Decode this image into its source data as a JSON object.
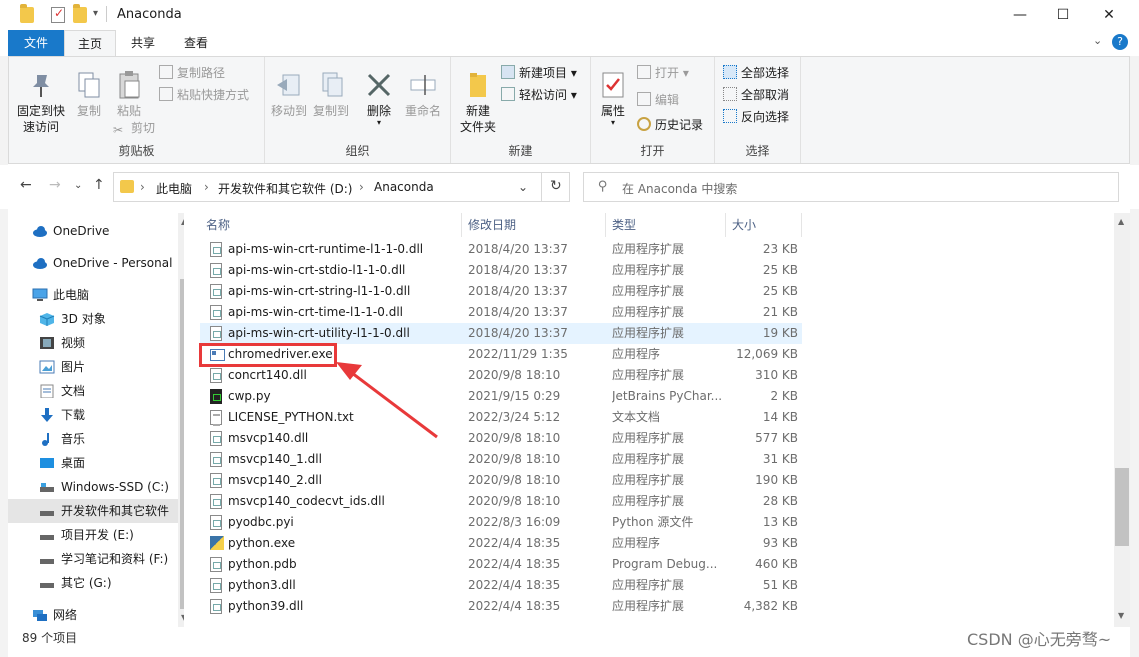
{
  "window": {
    "title": "Anaconda",
    "minimize": "—",
    "maximize": "☐",
    "close": "✕"
  },
  "ribbon_tabs": [
    "文件",
    "主页",
    "共享",
    "查看"
  ],
  "ribbon": {
    "clipboard": {
      "pin": "固定到快速访问",
      "pin_l1": "固定到快",
      "pin_l2": "速访问",
      "copy": "复制",
      "paste": "粘贴",
      "copy_path": "复制路径",
      "paste_shortcut": "粘贴快捷方式",
      "cut": "剪切",
      "label": "剪贴板"
    },
    "organize": {
      "move_to": "移动到",
      "copy_to": "复制到",
      "delete": "删除",
      "rename": "重命名",
      "label": "组织"
    },
    "new": {
      "new_folder_l1": "新建",
      "new_folder_l2": "文件夹",
      "new_item": "新建项目",
      "easy_access": "轻松访问",
      "label": "新建"
    },
    "open": {
      "properties": "属性",
      "open": "打开",
      "edit": "编辑",
      "history": "历史记录",
      "label": "打开"
    },
    "select": {
      "select_all": "全部选择",
      "select_none": "全部取消",
      "invert": "反向选择",
      "label": "选择"
    }
  },
  "address": {
    "segments": [
      "此电脑",
      "开发软件和其它软件 (D:)",
      "Anaconda"
    ],
    "search_placeholder": "在 Anaconda 中搜索"
  },
  "nav": [
    {
      "label": "OneDrive",
      "icon": "cloud-icon"
    },
    {
      "label": "OneDrive - Personal",
      "icon": "cloud-icon"
    },
    {
      "label": "此电脑",
      "icon": "computer-icon"
    },
    {
      "label": "3D 对象",
      "icon": "3d-objects-icon"
    },
    {
      "label": "视频",
      "icon": "video-icon"
    },
    {
      "label": "图片",
      "icon": "pictures-icon"
    },
    {
      "label": "文档",
      "icon": "documents-icon"
    },
    {
      "label": "下载",
      "icon": "download-icon"
    },
    {
      "label": "音乐",
      "icon": "music-icon"
    },
    {
      "label": "桌面",
      "icon": "desktop-icon"
    },
    {
      "label": "Windows-SSD (C:)",
      "icon": "drive-icon"
    },
    {
      "label": "开发软件和其它软件",
      "icon": "drive-icon"
    },
    {
      "label": "项目开发 (E:)",
      "icon": "drive-icon"
    },
    {
      "label": "学习笔记和资料 (F:)",
      "icon": "drive-icon"
    },
    {
      "label": "其它 (G:)",
      "icon": "drive-icon"
    },
    {
      "label": "网络",
      "icon": "network-icon"
    }
  ],
  "columns": {
    "name": "名称",
    "date": "修改日期",
    "type": "类型",
    "size": "大小"
  },
  "files": [
    {
      "name": "api-ms-win-crt-runtime-l1-1-0.dll",
      "date": "2018/4/20 13:37",
      "type": "应用程序扩展",
      "size": "23 KB",
      "icon": "dll"
    },
    {
      "name": "api-ms-win-crt-stdio-l1-1-0.dll",
      "date": "2018/4/20 13:37",
      "type": "应用程序扩展",
      "size": "25 KB",
      "icon": "dll"
    },
    {
      "name": "api-ms-win-crt-string-l1-1-0.dll",
      "date": "2018/4/20 13:37",
      "type": "应用程序扩展",
      "size": "25 KB",
      "icon": "dll"
    },
    {
      "name": "api-ms-win-crt-time-l1-1-0.dll",
      "date": "2018/4/20 13:37",
      "type": "应用程序扩展",
      "size": "21 KB",
      "icon": "dll"
    },
    {
      "name": "api-ms-win-crt-utility-l1-1-0.dll",
      "date": "2018/4/20 13:37",
      "type": "应用程序扩展",
      "size": "19 KB",
      "icon": "dll"
    },
    {
      "name": "chromedriver.exe",
      "date": "2022/11/29 1:35",
      "type": "应用程序",
      "size": "12,069 KB",
      "icon": "exe"
    },
    {
      "name": "concrt140.dll",
      "date": "2020/9/8 18:10",
      "type": "应用程序扩展",
      "size": "310 KB",
      "icon": "dll"
    },
    {
      "name": "cwp.py",
      "date": "2021/9/15 0:29",
      "type": "JetBrains PyChar...",
      "size": "2 KB",
      "icon": "pyc"
    },
    {
      "name": "LICENSE_PYTHON.txt",
      "date": "2022/3/24 5:12",
      "type": "文本文档",
      "size": "14 KB",
      "icon": "txt"
    },
    {
      "name": "msvcp140.dll",
      "date": "2020/9/8 18:10",
      "type": "应用程序扩展",
      "size": "577 KB",
      "icon": "dll"
    },
    {
      "name": "msvcp140_1.dll",
      "date": "2020/9/8 18:10",
      "type": "应用程序扩展",
      "size": "31 KB",
      "icon": "dll"
    },
    {
      "name": "msvcp140_2.dll",
      "date": "2020/9/8 18:10",
      "type": "应用程序扩展",
      "size": "190 KB",
      "icon": "dll"
    },
    {
      "name": "msvcp140_codecvt_ids.dll",
      "date": "2020/9/8 18:10",
      "type": "应用程序扩展",
      "size": "28 KB",
      "icon": "dll"
    },
    {
      "name": "pyodbc.pyi",
      "date": "2022/8/3 16:09",
      "type": "Python 源文件",
      "size": "13 KB",
      "icon": "py"
    },
    {
      "name": "python.exe",
      "date": "2022/4/4 18:35",
      "type": "应用程序",
      "size": "93 KB",
      "icon": "pyexe"
    },
    {
      "name": "python.pdb",
      "date": "2022/4/4 18:35",
      "type": "Program Debug...",
      "size": "460 KB",
      "icon": "pdb"
    },
    {
      "name": "python3.dll",
      "date": "2022/4/4 18:35",
      "type": "应用程序扩展",
      "size": "51 KB",
      "icon": "dll"
    },
    {
      "name": "python39.dll",
      "date": "2022/4/4 18:35",
      "type": "应用程序扩展",
      "size": "4,382 KB",
      "icon": "dll"
    }
  ],
  "status": {
    "item_count": "89 个项目"
  },
  "watermark": "CSDN @心无旁骛~",
  "colors": {
    "accent": "#1979ca",
    "highlight": "#e8393a",
    "hover_row": "#e5f3ff"
  }
}
